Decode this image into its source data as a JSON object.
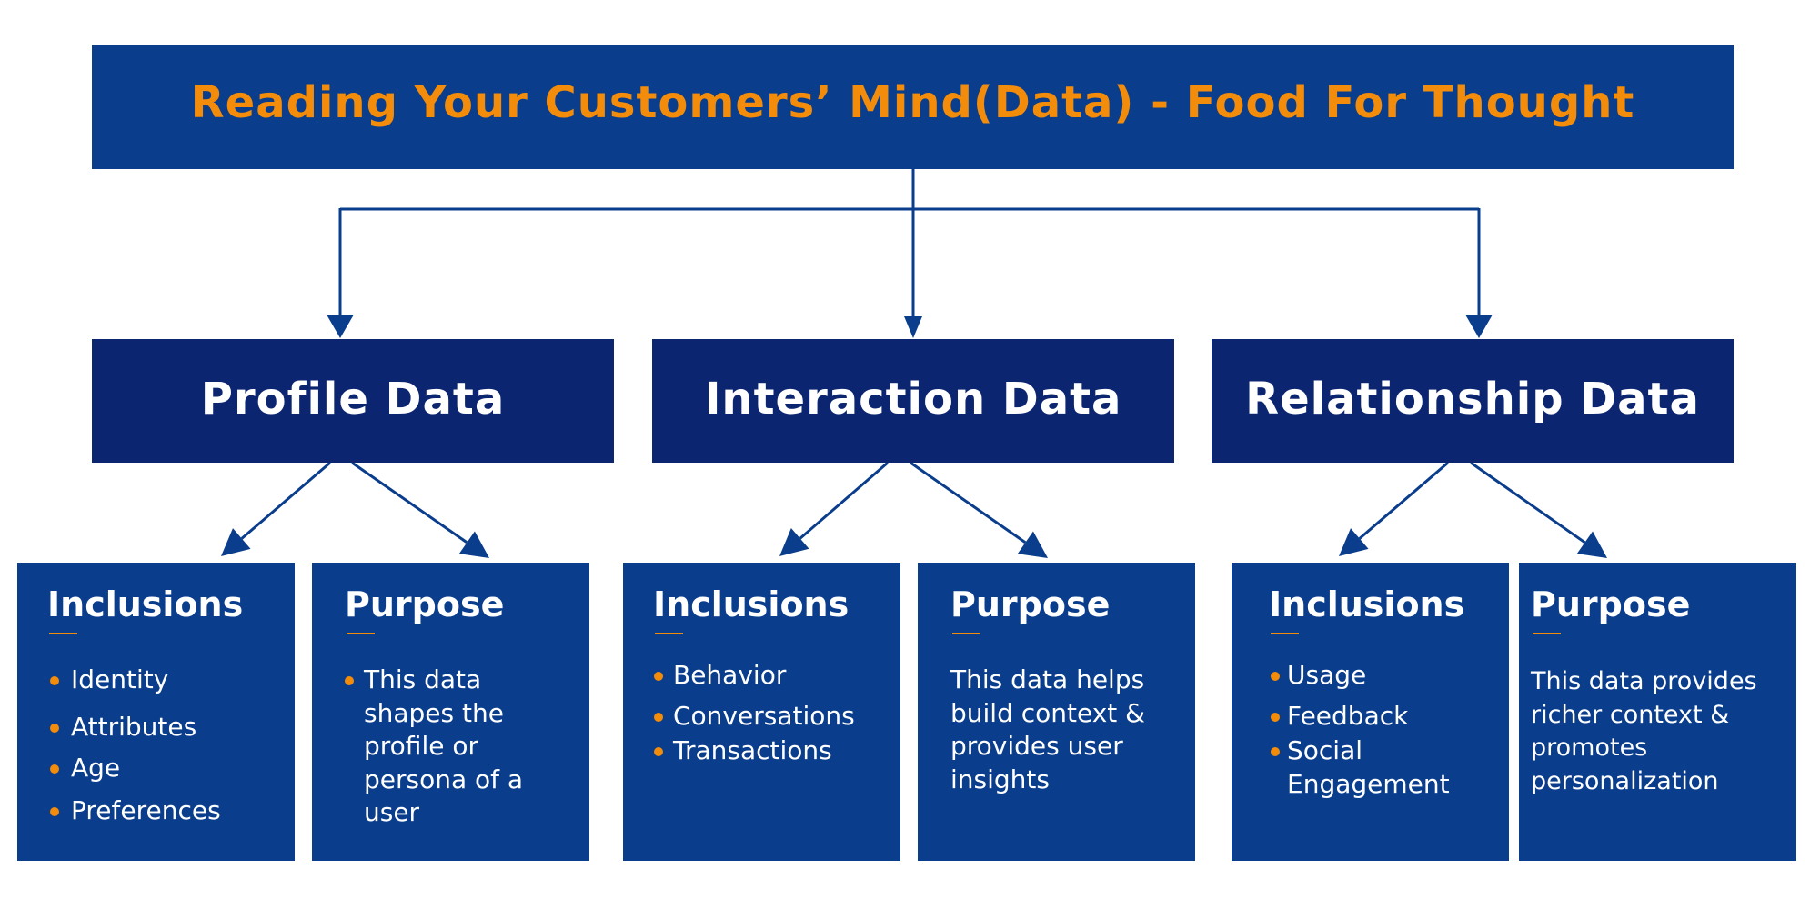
{
  "title": "Reading Your Customers’ Mind(Data) - Food For Thought",
  "colors": {
    "title_bg": "#0a3d8b",
    "category_bg": "#0c2570",
    "leaf_bg": "#0a3d8b",
    "accent": "#f28c0a",
    "connector": "#0a3d8b",
    "text": "#ffffff"
  },
  "categories": [
    {
      "name": "Profile Data",
      "inclusions": {
        "heading": "Inclusions",
        "items": [
          "Identity",
          "Attributes",
          "Age",
          "Preferences"
        ]
      },
      "purpose": {
        "heading": "Purpose",
        "bulleted": true,
        "lines": [
          "This data",
          "shapes the",
          "profile or",
          "persona of a",
          "user"
        ]
      }
    },
    {
      "name": "Interaction Data",
      "inclusions": {
        "heading": "Inclusions",
        "items": [
          "Behavior",
          "Conversations",
          "Transactions"
        ]
      },
      "purpose": {
        "heading": "Purpose",
        "bulleted": false,
        "lines": [
          "This data helps",
          "build context &",
          "provides user",
          "insights"
        ]
      }
    },
    {
      "name": "Relationship Data",
      "inclusions": {
        "heading": "Inclusions",
        "items": [
          "Usage",
          "Feedback",
          "Social",
          "Engagement"
        ]
      },
      "purpose": {
        "heading": "Purpose",
        "bulleted": false,
        "lines": [
          "This data provides",
          "richer context &",
          "promotes",
          "personalization"
        ]
      }
    }
  ]
}
